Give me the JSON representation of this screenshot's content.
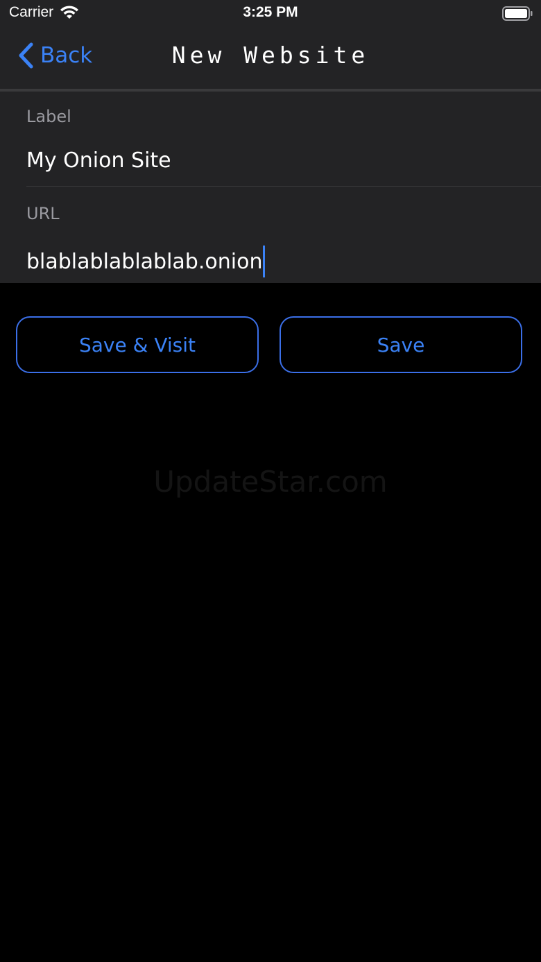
{
  "status_bar": {
    "carrier": "Carrier",
    "time": "3:25 PM",
    "icons": [
      "wifi-icon",
      "battery-icon"
    ]
  },
  "nav": {
    "back_label": "Back",
    "back_icon": "chevron-left-icon",
    "title": "New Website"
  },
  "form": {
    "label_caption": "Label",
    "label_value": "My Onion Site",
    "url_caption": "URL",
    "url_value": "blablablablablab.onion"
  },
  "actions": {
    "save_visit_label": "Save & Visit",
    "save_label": "Save"
  },
  "watermark": "UpdateStar.com",
  "colors": {
    "accent": "#3b82f6",
    "bar_background": "#232325",
    "page_background": "#000000"
  }
}
